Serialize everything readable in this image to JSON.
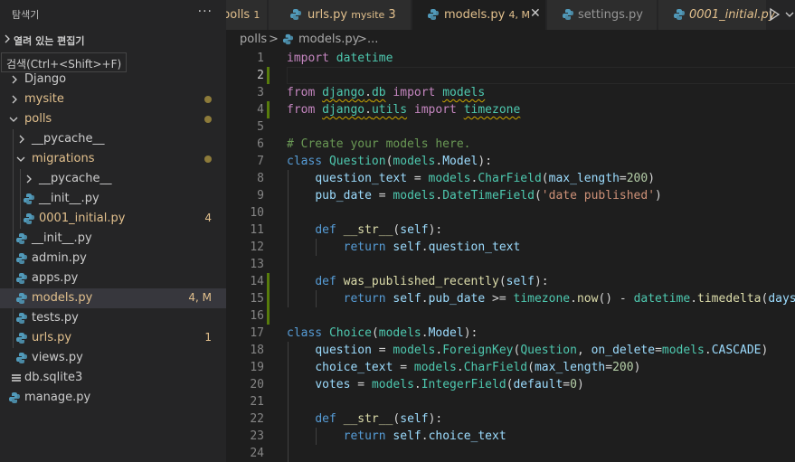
{
  "sidebar": {
    "title": "탐색기",
    "more_icon": "ellipsis-icon",
    "open_editors_label": "열려 있는 편집기",
    "tooltip": "검색(Ctrl+<Shift>+F)",
    "tree": [
      {
        "name": "Django",
        "kind": "folder",
        "collapsed": true
      },
      {
        "name": "mysite",
        "kind": "folder",
        "collapsed": true,
        "status": "dot"
      },
      {
        "name": "polls",
        "kind": "folder",
        "collapsed": false,
        "status": "dot"
      },
      {
        "name": "__pycache__",
        "kind": "folder",
        "collapsed": true
      },
      {
        "name": "migrations",
        "kind": "folder",
        "collapsed": false,
        "status": "dot"
      },
      {
        "name": "__pycache__",
        "kind": "folder",
        "collapsed": true
      },
      {
        "name": "__init__.py",
        "kind": "python-file"
      },
      {
        "name": "0001_initial.py",
        "kind": "python-file",
        "badge": "4"
      },
      {
        "name": "__init__.py",
        "kind": "python-file"
      },
      {
        "name": "admin.py",
        "kind": "python-file"
      },
      {
        "name": "apps.py",
        "kind": "python-file"
      },
      {
        "name": "models.py",
        "kind": "python-file",
        "badge": "4, M",
        "selected": true
      },
      {
        "name": "tests.py",
        "kind": "python-file"
      },
      {
        "name": "urls.py",
        "kind": "python-file",
        "badge": "1"
      },
      {
        "name": "views.py",
        "kind": "python-file"
      },
      {
        "name": "db.sqlite3",
        "kind": "db-file"
      },
      {
        "name": "manage.py",
        "kind": "python-file"
      }
    ]
  },
  "tabs": [
    {
      "label": "polls",
      "badge": "1",
      "icon": "python-icon"
    },
    {
      "label": "urls.py",
      "description": "mysite",
      "badge": "3",
      "icon": "python-icon"
    },
    {
      "label": "models.py",
      "badge": "4, M",
      "active": true,
      "icon": "python-icon",
      "close_icon": "close-icon"
    },
    {
      "label": "settings.py",
      "icon": "python-icon"
    },
    {
      "label": "0001_initial.py",
      "icon": "python-icon"
    }
  ],
  "toolbar": {
    "run_icon": "run-icon",
    "caret_icon": "chevron-down-icon"
  },
  "breadcrumb": [
    "polls",
    ">",
    "models.py",
    ">",
    "..."
  ],
  "editor": {
    "active_line": 2,
    "lines": [
      {
        "n": "1",
        "text": "import datetime"
      },
      {
        "n": "2",
        "text": ""
      },
      {
        "n": "3",
        "text": "from django.db import models"
      },
      {
        "n": "4",
        "text": "from django.utils import timezone"
      },
      {
        "n": "5",
        "text": ""
      },
      {
        "n": "6",
        "text": "# Create your models here."
      },
      {
        "n": "7",
        "text": "class Question(models.Model):"
      },
      {
        "n": "8",
        "text": "    question_text = models.CharField(max_length=200)"
      },
      {
        "n": "9",
        "text": "    pub_date = models.DateTimeField('date published')"
      },
      {
        "n": "10",
        "text": ""
      },
      {
        "n": "11",
        "text": "    def __str__(self):"
      },
      {
        "n": "12",
        "text": "        return self.question_text"
      },
      {
        "n": "13",
        "text": ""
      },
      {
        "n": "14",
        "text": "    def was_published_recently(self):"
      },
      {
        "n": "15",
        "text": "        return self.pub_date >= timezone.now() - datetime.timedelta(days="
      },
      {
        "n": "16",
        "text": ""
      },
      {
        "n": "17",
        "text": "class Choice(models.Model):"
      },
      {
        "n": "18",
        "text": "    question = models.ForeignKey(Question, on_delete=models.CASCADE)"
      },
      {
        "n": "19",
        "text": "    choice_text = models.CharField(max_length=200)"
      },
      {
        "n": "20",
        "text": "    votes = models.IntegerField(default=0)"
      },
      {
        "n": "21",
        "text": ""
      },
      {
        "n": "22",
        "text": "    def __str__(self):"
      },
      {
        "n": "23",
        "text": "        return self.choice_text"
      },
      {
        "n": "24",
        "text": ""
      }
    ]
  },
  "colors": {
    "modified": "#e2c08d",
    "added_gutter": "#587c0c",
    "keyword": "#569cd6",
    "import_keyword": "#c586c0",
    "class_type": "#4ec9b0",
    "function": "#dcdcaa",
    "variable": "#9cdcfe",
    "number": "#b5cea8",
    "string": "#ce9178",
    "comment": "#6a9955"
  }
}
